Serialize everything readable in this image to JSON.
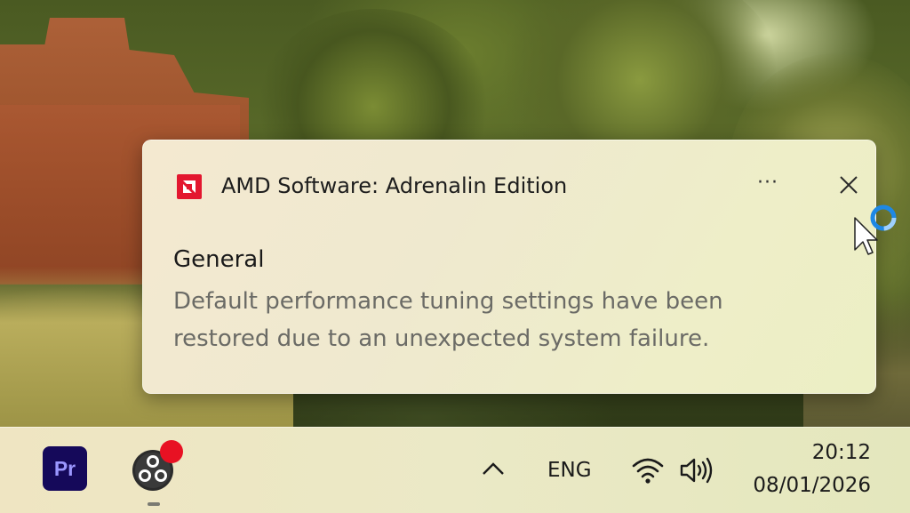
{
  "notification": {
    "app_name": "AMD Software: Adrenalin Edition",
    "more_label": "···",
    "title": "General",
    "body": "Default performance tuning settings have been restored due to an unexpected system failure.",
    "logo_icon": "amd-logo-icon",
    "close_icon": "close-icon",
    "accent_color": "#e3172f"
  },
  "taskbar": {
    "apps": [
      {
        "name": "Adobe Premiere Pro",
        "label": "Pr",
        "icon": "premiere-pro-icon",
        "color": "#15095a"
      },
      {
        "name": "OBS Studio",
        "icon": "obs-studio-icon",
        "badge_color": "#e81123",
        "running": true
      }
    ],
    "tray": {
      "overflow_icon": "chevron-up-icon",
      "language": "ENG",
      "wifi_icon": "wifi-icon",
      "volume_icon": "volume-icon"
    },
    "clock": {
      "time": "20:12",
      "date": "08/01/2026"
    }
  },
  "cursor": {
    "icon": "arrow-cursor-icon",
    "busy_icon": "busy-spinner-icon",
    "spinner_color": "#1e88e5"
  }
}
